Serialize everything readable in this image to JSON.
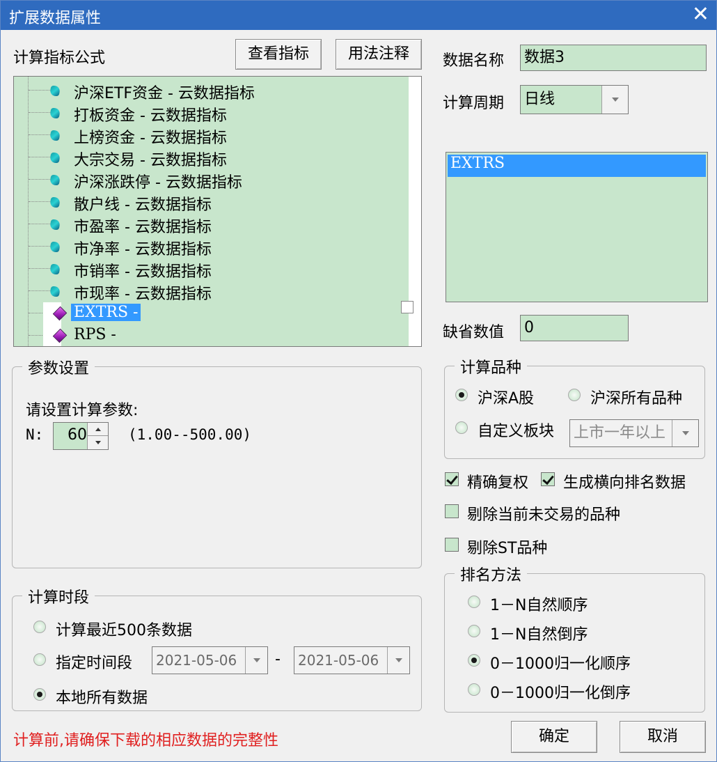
{
  "window": {
    "title": "扩展数据属性",
    "close_glyph": "✕"
  },
  "formula": {
    "label": "计算指标公式",
    "view_button": "查看指标",
    "usage_button": "用法注释",
    "items": [
      "沪深ETF资金 - 云数据指标",
      "打板资金 - 云数据指标",
      "上榜资金 - 云数据指标",
      "大宗交易 - 云数据指标",
      "沪深涨跌停 - 云数据指标",
      "散户线 - 云数据指标",
      "市盈率 - 云数据指标",
      "市净率 - 云数据指标",
      "市销率 - 云数据指标",
      "市现率 - 云数据指标",
      "EXTRS -",
      "RPS -"
    ],
    "selected_index": 10
  },
  "data_name": {
    "label": "数据名称",
    "value": "数据3"
  },
  "period": {
    "label": "计算周期",
    "value": "日线"
  },
  "list": {
    "items": [
      "EXTRS"
    ]
  },
  "default_value": {
    "label": "缺省数值",
    "value": "0"
  },
  "params": {
    "group_title": "参数设置",
    "prompt": "请设置计算参数:",
    "n_label": "N:",
    "n_value": "60",
    "range": "(1.00--500.00)"
  },
  "variety": {
    "group_title": "计算品种",
    "opt_a": "沪深A股",
    "opt_all": "沪深所有品种",
    "opt_custom": "自定义板块",
    "custom_select": "上市一年以上",
    "selected": "沪深A股"
  },
  "checks": {
    "exact_adjust": "精确复权",
    "gen_rank": "生成横向排名数据",
    "exclude_untraded": "剔除当前未交易的品种",
    "exclude_st": "剔除ST品种"
  },
  "rank": {
    "group_title": "排名方法",
    "opt1": "1－N自然顺序",
    "opt2": "1－N自然倒序",
    "opt3": "0－1000归一化顺序",
    "opt4": "0－1000归一化倒序",
    "selected": "0－1000归一化顺序"
  },
  "period_range": {
    "group_title": "计算时段",
    "opt_recent": "计算最近500条数据",
    "opt_range": "指定时间段",
    "start_date": "2021-05-06",
    "dash": "-",
    "end_date": "2021-05-06",
    "opt_all": "本地所有数据",
    "selected": "本地所有数据"
  },
  "warning": {
    "text": "计算前,请确保下载的相应数据的完整性",
    "color": "#e02020"
  },
  "buttons": {
    "ok": "确定",
    "cancel": "取消"
  },
  "colors": {
    "field_bg": "#c8e6cc",
    "selection": "#3399ff",
    "titlebar": "#2f6bbf"
  }
}
